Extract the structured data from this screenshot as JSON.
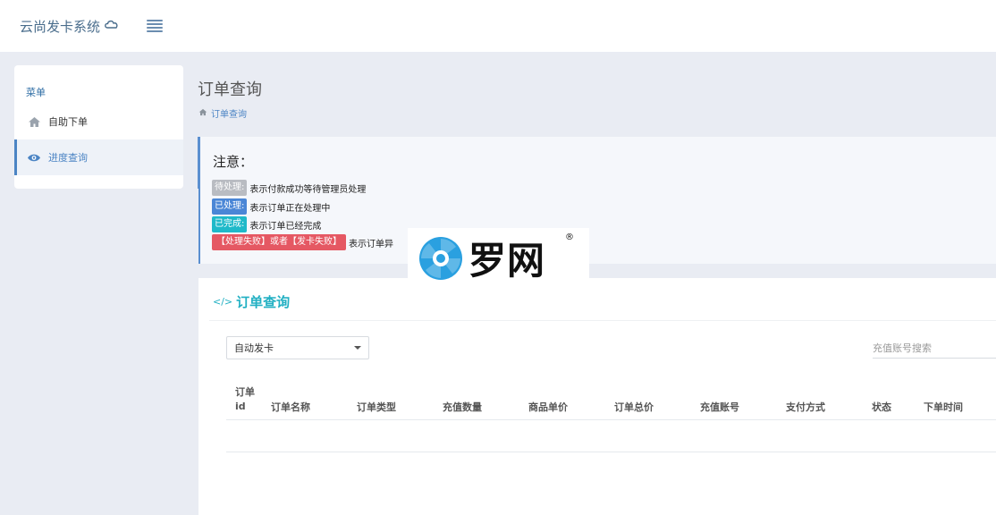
{
  "header": {
    "brand": "云尚发卡系统",
    "brand_icon": "cloud-icon",
    "menu_toggle_icon": "list-icon"
  },
  "sidebar": {
    "title": "菜单",
    "items": [
      {
        "label": "自助下单",
        "icon": "home-icon",
        "active": false
      },
      {
        "label": "进度查询",
        "icon": "eye-icon",
        "active": true
      }
    ]
  },
  "page": {
    "title": "订单查询",
    "breadcrumb": "订单查询"
  },
  "notice": {
    "title": "注意：",
    "lines": [
      {
        "tag": "待处理:",
        "tag_color": "#b9bcc2",
        "text": "表示付款成功等待管理员处理"
      },
      {
        "tag": "已处理:",
        "tag_color": "#4a86d6",
        "text": "表示订单正在处理中"
      },
      {
        "tag": "已完成:",
        "tag_color": "#1fb9c9",
        "text": "表示订单已经完成"
      },
      {
        "tag": "【处理失败】或者【发卡失败】",
        "tag_color": "#e55863",
        "text": "表示订单异"
      }
    ]
  },
  "card": {
    "title": "订单查询",
    "title_icon": "code-icon",
    "select_value": "自动发卡",
    "search_placeholder": "充值账号搜索",
    "columns": [
      "订单id",
      "订单名称",
      "订单类型",
      "充值数量",
      "商品单价",
      "订单总价",
      "充值账号",
      "支付方式",
      "状态",
      "下单时间"
    ]
  },
  "watermark": {
    "text": "罗网",
    "registered": "®"
  },
  "colors": {
    "accent": "#4b84c4",
    "card_title": "#22b0c3",
    "background": "#e9ecf3"
  }
}
